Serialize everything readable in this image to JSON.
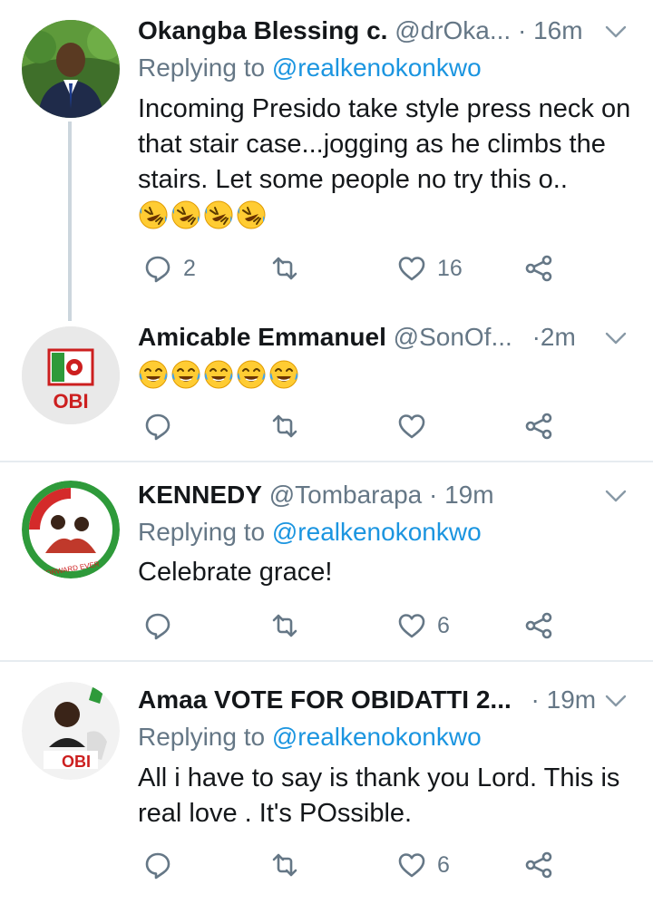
{
  "tweets": [
    {
      "name": "Okangba Blessing c.",
      "handle": "@drOka...",
      "time": "16m",
      "replying_prefix": "Replying to ",
      "replying_to": "@realkenokonkwo",
      "text": "Incoming Presido take style press neck on that stair case...jogging as he climbs the stairs. Let some people no try this o..",
      "emoji_count": 4,
      "emoji_type": "rofl",
      "replies": "2",
      "retweets": "",
      "likes": "16"
    },
    {
      "name": "Amicable Emmanuel",
      "handle": "@SonOf...",
      "time": "2m",
      "avatar_text": "OBI",
      "emoji_count": 5,
      "emoji_type": "tears-of-joy",
      "replies": "",
      "retweets": "",
      "likes": ""
    },
    {
      "name": "KENNEDY",
      "handle": "@Tombarapa",
      "time": "19m",
      "avatar_text": "FORWARD EVER",
      "replying_prefix": "Replying to ",
      "replying_to": "@realkenokonkwo",
      "text": "Celebrate grace!",
      "replies": "",
      "retweets": "",
      "likes": "6"
    },
    {
      "name": "Amaa VOTE FOR OBIDATTI 2...",
      "handle": "",
      "time": "19m",
      "avatar_text": "OBI",
      "replying_prefix": "Replying to ",
      "replying_to": "@realkenokonkwo",
      "text": "All i have to say is thank you Lord. This is real love . It's POssible.",
      "replies": "",
      "retweets": "",
      "likes": "6"
    }
  ],
  "separator": "·",
  "colors": {
    "text": "#14171a",
    "secondary": "#657786",
    "link": "#1b95e0",
    "divider": "#e6ecf0",
    "thread_line": "#ccd6dd"
  },
  "icons": [
    "reply-icon",
    "retweet-icon",
    "like-icon",
    "share-icon",
    "caret-down-icon"
  ]
}
